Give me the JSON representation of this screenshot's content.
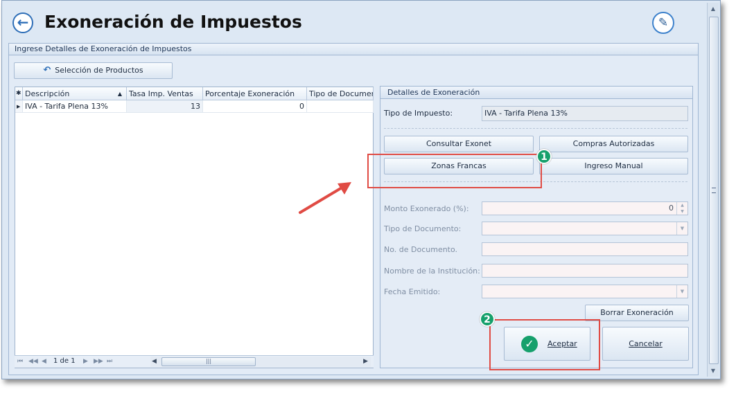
{
  "window": {
    "title": "Exoneración de Impuestos",
    "back_icon": "arrow-left-circle-icon",
    "edit_icon": "edit-pencil-icon"
  },
  "main_group": {
    "header": "Ingrese Detalles de Exoneración de Impuestos",
    "select_products_label": "Selección de Productos"
  },
  "grid": {
    "columns": [
      "Descripción",
      "Tasa Imp. Ventas",
      "Porcentaje Exoneración",
      "Tipo de Documen"
    ],
    "rows": [
      {
        "descripcion": "IVA - Tarifa Plena 13%",
        "tasa": "13",
        "porcentaje": "0",
        "tipo": ""
      }
    ],
    "pager_text": "1 de 1"
  },
  "details": {
    "header": "Detalles de Exoneración",
    "tipo_impuesto_label": "Tipo de Impuesto:",
    "tipo_impuesto_value": "IVA - Tarifa Plena 13%",
    "buttons": {
      "consultar_exonet": "Consultar Exonet",
      "compras_autorizadas": "Compras Autorizadas",
      "zonas_francas": "Zonas Francas",
      "ingreso_manual": "Ingreso Manual",
      "borrar_exoneracion": "Borrar Exoneración",
      "aceptar": "Aceptar",
      "cancelar": "Cancelar"
    },
    "fields": {
      "monto_label": "Monto Exonerado (%):",
      "monto_value": "0",
      "tipo_documento_label": "Tipo de Documento:",
      "no_documento_label": "No. de Documento.",
      "institucion_label": "Nombre de la Institución:",
      "fecha_label": "Fecha Emitido:"
    }
  },
  "annotations": {
    "badge_1": "1",
    "badge_2": "2",
    "highlight_color": "#e04b44",
    "badge_color": "#16a06c"
  }
}
